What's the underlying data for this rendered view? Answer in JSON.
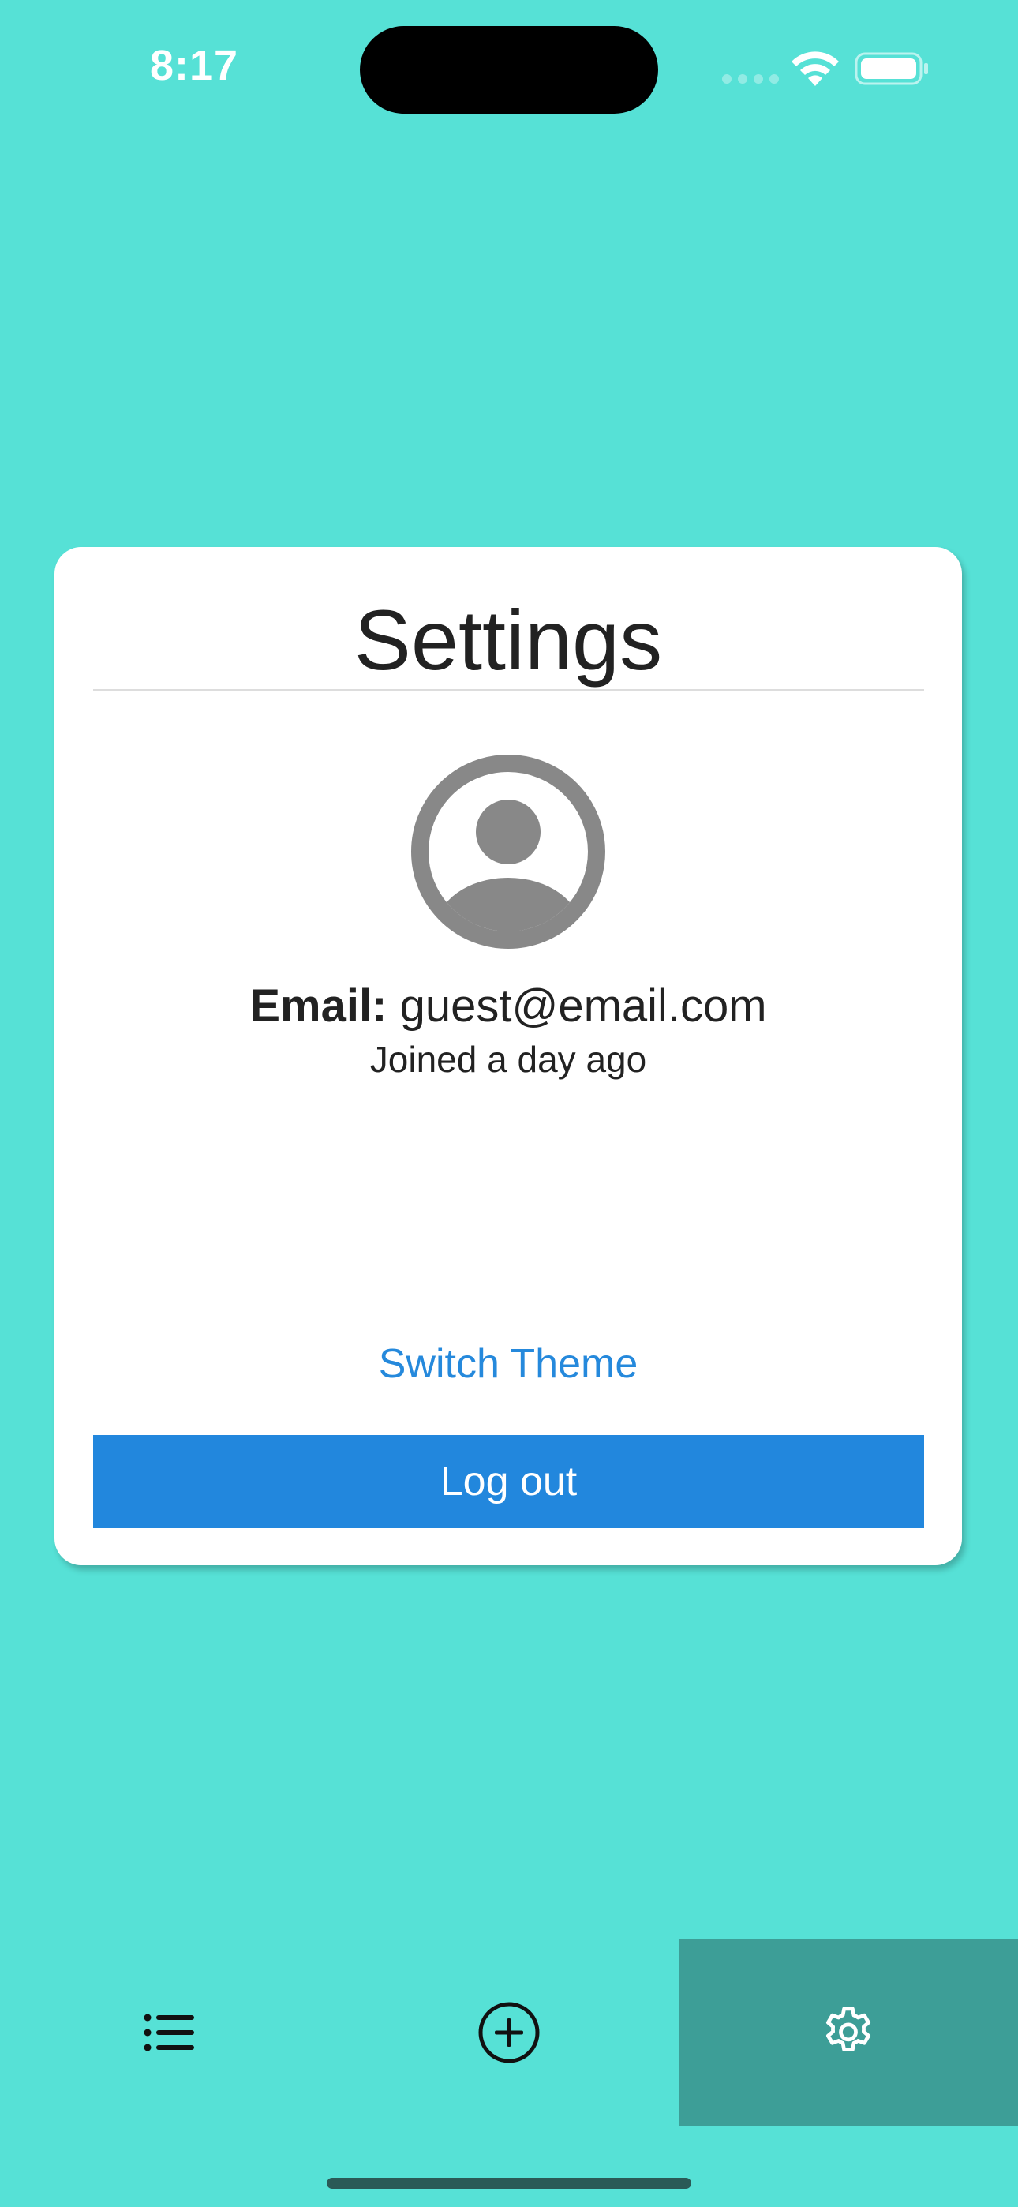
{
  "status_bar": {
    "time": "8:17"
  },
  "settings_card": {
    "title": "Settings",
    "email_label": "Email:",
    "email_value": "guest@email.com",
    "joined_text": "Joined a day ago",
    "switch_theme_label": "Switch Theme",
    "logout_label": "Log out",
    "avatar_icon": "person-circle-icon"
  },
  "tab_bar": {
    "tabs": [
      {
        "icon": "list-icon",
        "active": false
      },
      {
        "icon": "plus-circle-icon",
        "active": false
      },
      {
        "icon": "gear-icon",
        "active": true
      }
    ]
  },
  "colors": {
    "background": "#56E1D6",
    "active_tab": "#3D9E97",
    "accent": "#2287DD",
    "link": "#2589DC",
    "card": "#FFFFFF",
    "avatar": "#888888"
  }
}
